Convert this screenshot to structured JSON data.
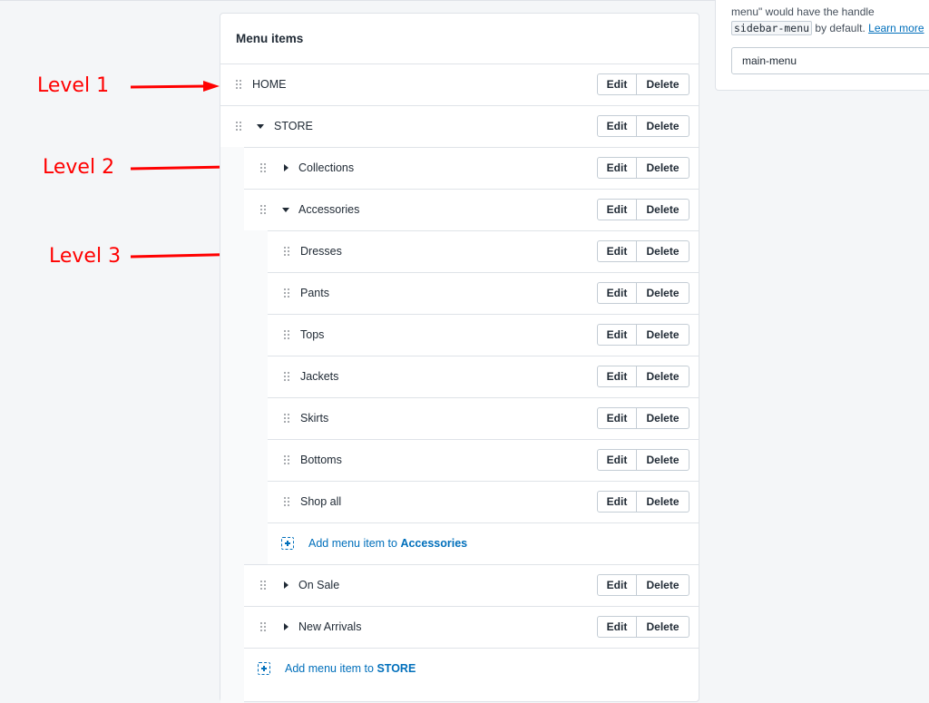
{
  "annotations": {
    "level1": "Level 1",
    "level2": "Level 2",
    "level3": "Level 3",
    "arrow_color": "#ff0000"
  },
  "card": {
    "title": "Menu items"
  },
  "buttons": {
    "edit": "Edit",
    "delete": "Delete"
  },
  "items": {
    "home": "HOME",
    "store": "STORE",
    "collections": "Collections",
    "accessories": "Accessories",
    "dresses": "Dresses",
    "pants": "Pants",
    "tops": "Tops",
    "jackets": "Jackets",
    "skirts": "Skirts",
    "bottoms": "Bottoms",
    "shop_all": "Shop all",
    "on_sale": "On Sale",
    "new_arrivals": "New Arrivals"
  },
  "add": {
    "prefix": "Add menu item to ",
    "accessories_target": "Accessories",
    "store_target": "STORE"
  },
  "right_panel": {
    "text_line1": "menu\" would have the handle",
    "code": "sidebar-menu",
    "by_default": " by default. ",
    "learn_more": "Learn more",
    "handle_value": "main-menu"
  },
  "colors": {
    "link": "#006fbb",
    "border": "#dfe3e8",
    "annotation": "#ff0000"
  }
}
